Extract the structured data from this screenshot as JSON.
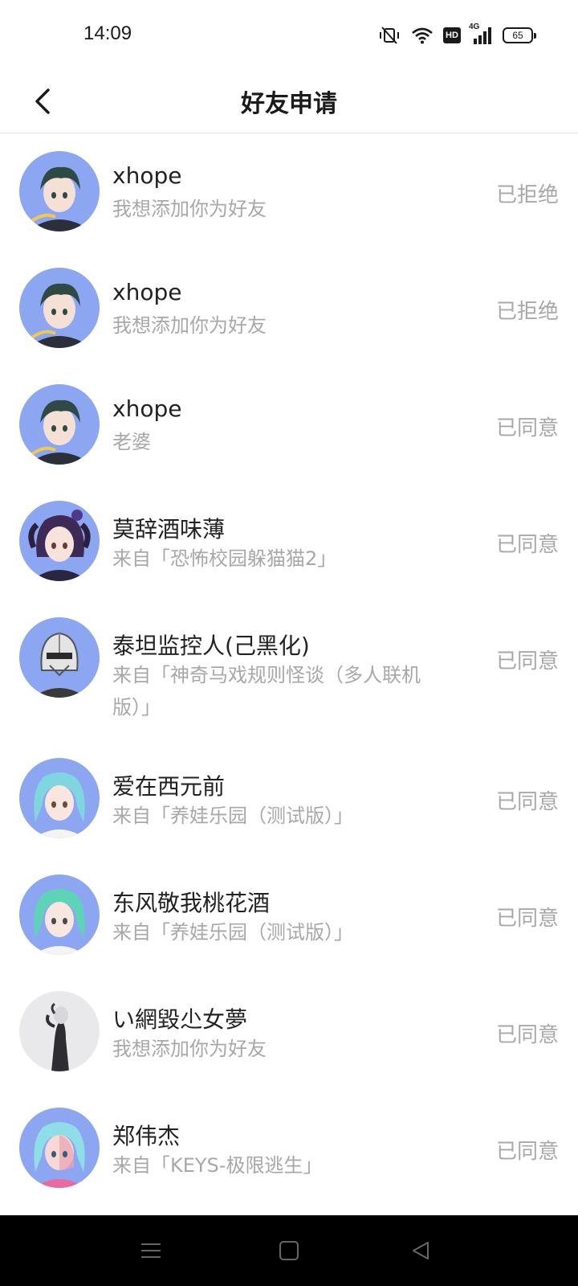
{
  "status_bar": {
    "time": "14:09",
    "network_label": "4G",
    "hd_label": "HD",
    "battery_level": "65",
    "icons": [
      "vibrate-mute-icon",
      "wifi-icon",
      "hd-icon",
      "cellular-signal-icon",
      "battery-icon"
    ]
  },
  "header": {
    "title": "好友申请",
    "back_icon": "chevron-left-icon"
  },
  "requests": [
    {
      "name": "xhope",
      "message": "我想添加你为好友",
      "status": "已拒绝",
      "avatar": "anime-boy-dark-hair"
    },
    {
      "name": "xhope",
      "message": "我想添加你为好友",
      "status": "已拒绝",
      "avatar": "anime-boy-dark-hair"
    },
    {
      "name": "xhope",
      "message": "老婆",
      "status": "已同意",
      "avatar": "anime-boy-dark-hair"
    },
    {
      "name": "莫辞酒味薄",
      "message": "来自「恐怖校园躲猫猫2」",
      "status": "已同意",
      "avatar": "anime-girl-horns"
    },
    {
      "name": "泰坦监控人(己黑化)",
      "message": "来自「神奇马戏规则怪谈（多人联机版）」",
      "status": "已同意",
      "avatar": "robot-helmet"
    },
    {
      "name": "爱在西元前",
      "message": "来自「养娃乐园（测试版）」",
      "status": "已同意",
      "avatar": "anime-girl-cyan-twintails"
    },
    {
      "name": "东风敬我桃花酒",
      "message": "来自「养娃乐园（测试版）」",
      "status": "已同意",
      "avatar": "anime-girl-green-twintails"
    },
    {
      "name": "い網毀尐女夢",
      "message": "我想添加你为好友",
      "status": "已同意",
      "avatar": "grey-figure"
    },
    {
      "name": "郑伟杰",
      "message": "来自「KEYS-极限逃生」",
      "status": "已同意",
      "avatar": "anime-girl-cyan-pink"
    }
  ],
  "system_nav": {
    "icons": [
      "menu-icon",
      "home-icon",
      "back-triangle-icon"
    ]
  },
  "colors": {
    "avatar_bg": "#8da6f2",
    "muted_text": "#a8a8a8",
    "primary_text": "#222222"
  }
}
